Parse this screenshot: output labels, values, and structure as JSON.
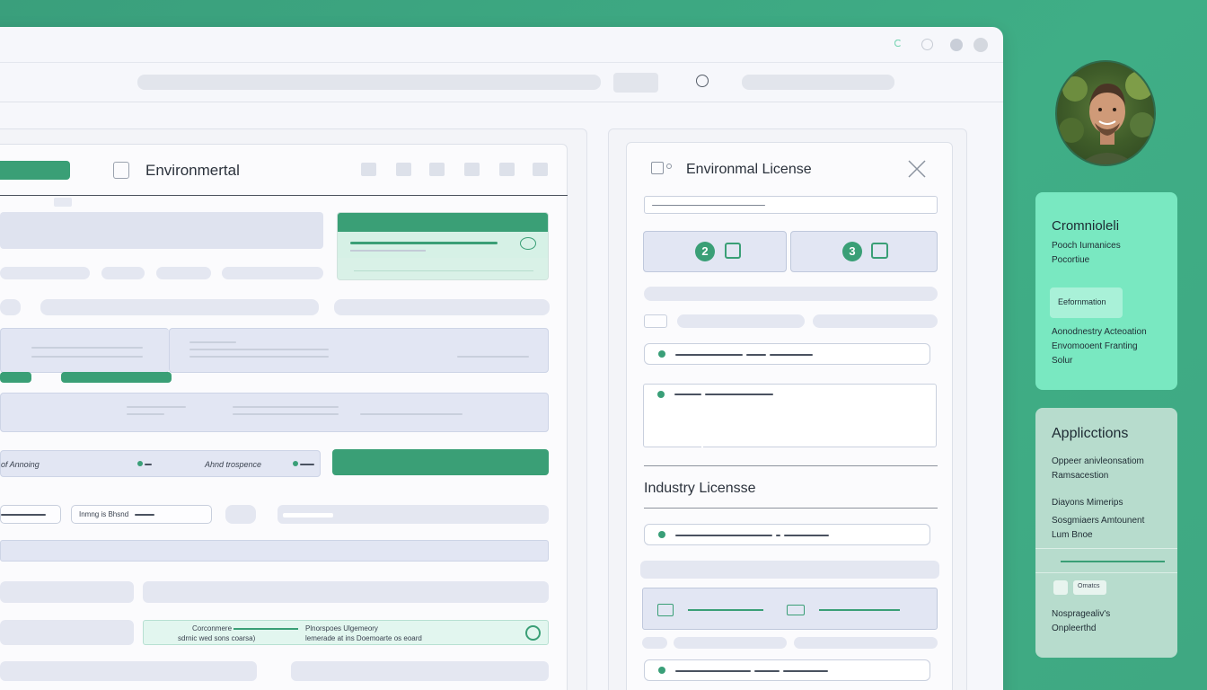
{
  "left_panel": {
    "title": "Environmertal",
    "filters": [
      "of Annoing",
      "Ahnd trospence"
    ],
    "chip_text": "Inmng is Bhsnd",
    "info_left": [
      "Corconmere",
      "sdrnic wed sons coarsa)"
    ],
    "info_right": [
      "Plnorspoes Ulgemeory",
      "lemerade at ins Doemoarte os eoard"
    ]
  },
  "dialog": {
    "title": "Environmal License",
    "options": [
      {
        "number": "2"
      },
      {
        "number": "3"
      }
    ],
    "section_title": "Industry Licensse"
  },
  "side_green": {
    "title": "Cromnioleli",
    "lines": [
      "Pooch Iumanices",
      "Pocortiue"
    ],
    "button_label": "Eefornmation",
    "lines2": [
      "Aonodnestry Acteoation",
      "Envomooent Franting",
      "Solur"
    ]
  },
  "side_grey": {
    "title": "Applicctions",
    "lines": [
      "Oppeer anivleonsatiom",
      "Ramsacestion"
    ],
    "lines2": [
      "Diayons Mimerips",
      "Sosgmiaers Amtounent",
      "Lum Bnoe"
    ],
    "chip": "Ornatcs",
    "lines3": [
      "Nospragealiv's",
      "Onpleerthd"
    ]
  },
  "colors": {
    "accent": "#3a9f76",
    "side_green": "#79e8c1",
    "side_grey": "#b7dccd",
    "background": "#3fae86"
  },
  "icons": [
    "document-icon",
    "save-icon",
    "close-icon",
    "calendar-icon",
    "globe-icon",
    "user-avatar"
  ]
}
